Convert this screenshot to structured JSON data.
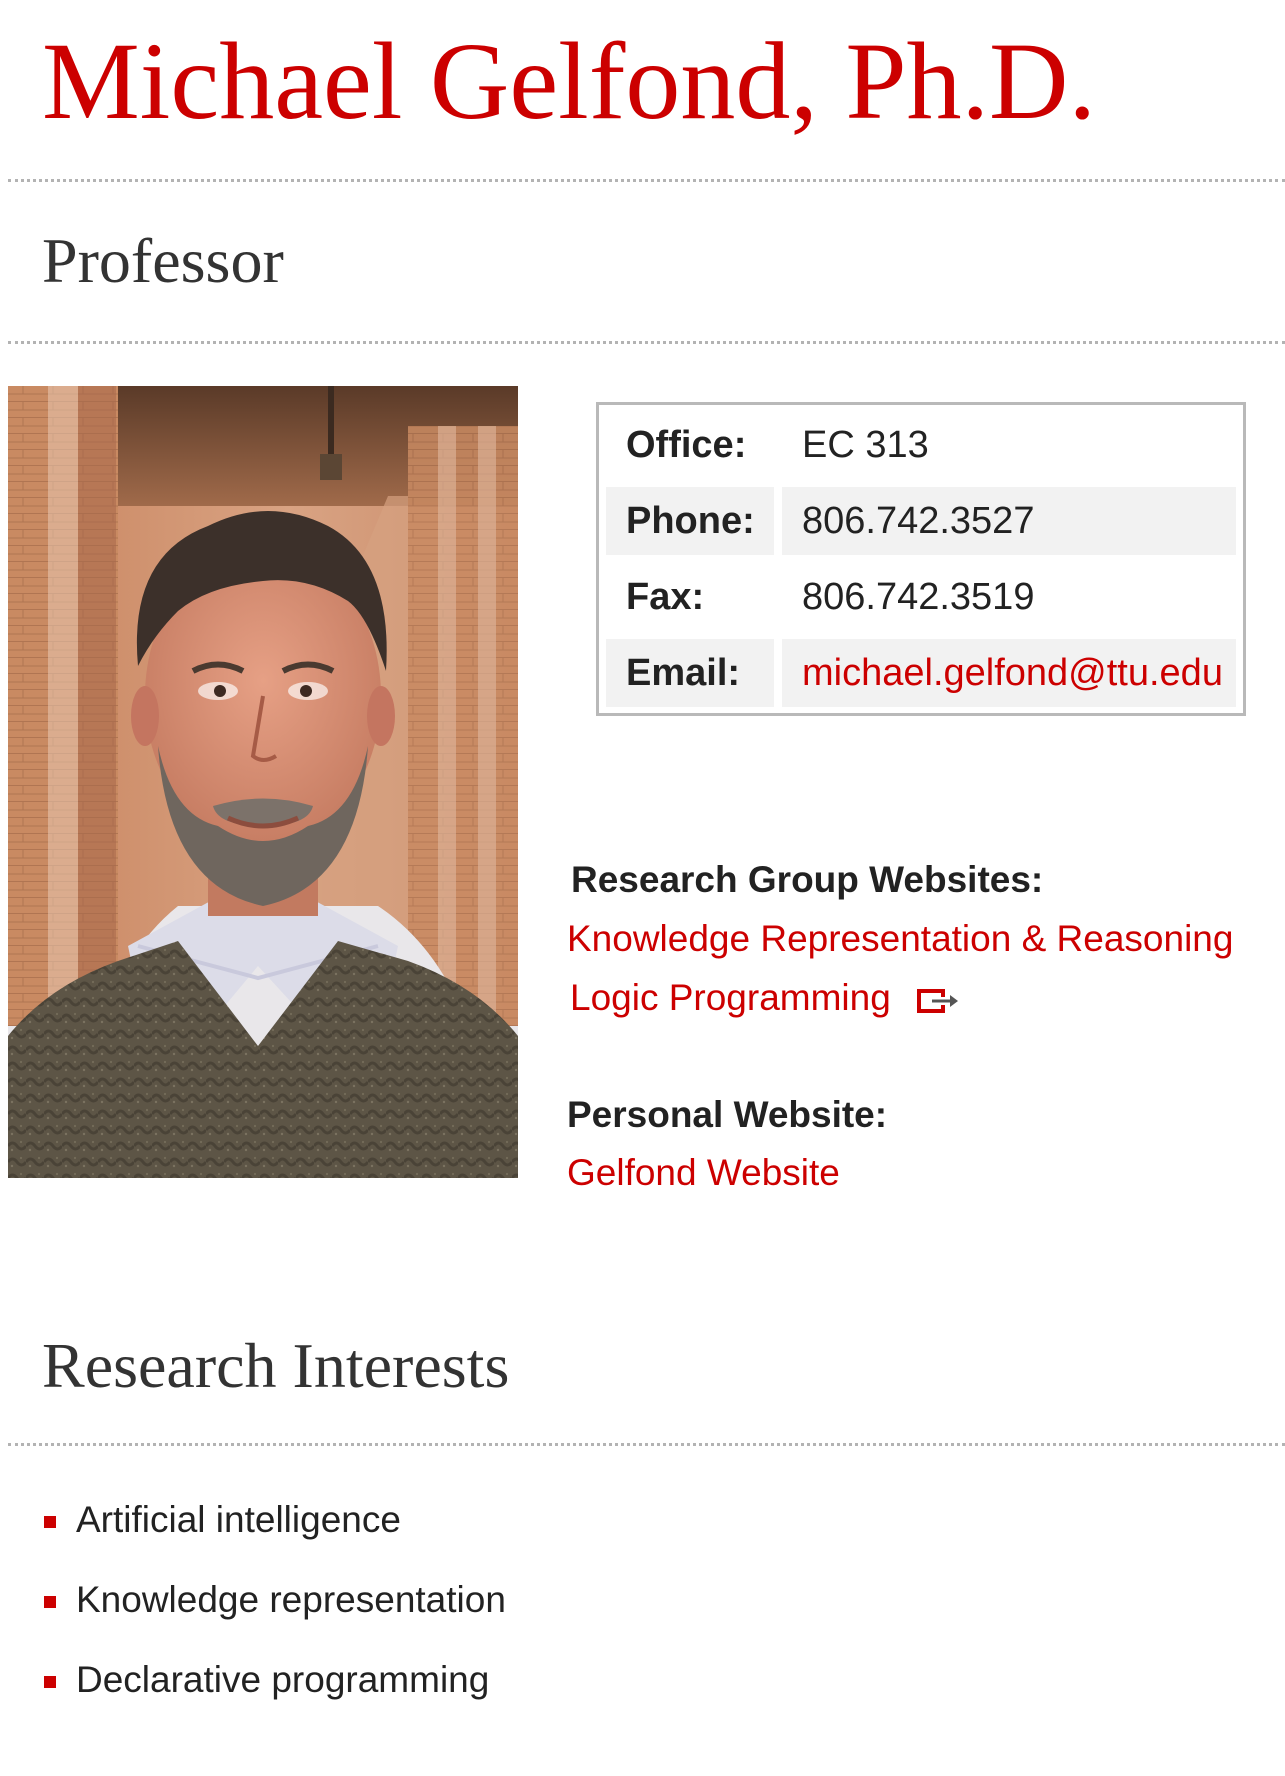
{
  "profile": {
    "name": "Michael Gelfond, Ph.D.",
    "title": "Professor",
    "photo_alt": "Michael Gelfond portrait"
  },
  "contact": {
    "rows": [
      {
        "label": "Office:",
        "value": "EC 313"
      },
      {
        "label": "Phone:",
        "value": "806.742.3527"
      },
      {
        "label": "Fax:",
        "value": "806.742.3519"
      },
      {
        "label": "Email:",
        "value": "michael.gelfond@ttu.edu"
      }
    ]
  },
  "research_groups": {
    "heading": "Research Group Websites:",
    "links": [
      {
        "label": "Knowledge Representation & Reasoning"
      },
      {
        "label": "Logic Programming",
        "icon": "external-link-icon"
      }
    ]
  },
  "personal": {
    "heading": "Personal Website:",
    "link_label": "Gelfond Website"
  },
  "interests": {
    "heading": "Research Interests",
    "items": [
      "Artificial intelligence",
      "Knowledge representation",
      "Declarative programming"
    ]
  },
  "colors": {
    "accent": "#cc0000",
    "divider": "#b3b3b3",
    "text": "#222222",
    "row_shade": "#f2f2f2"
  }
}
